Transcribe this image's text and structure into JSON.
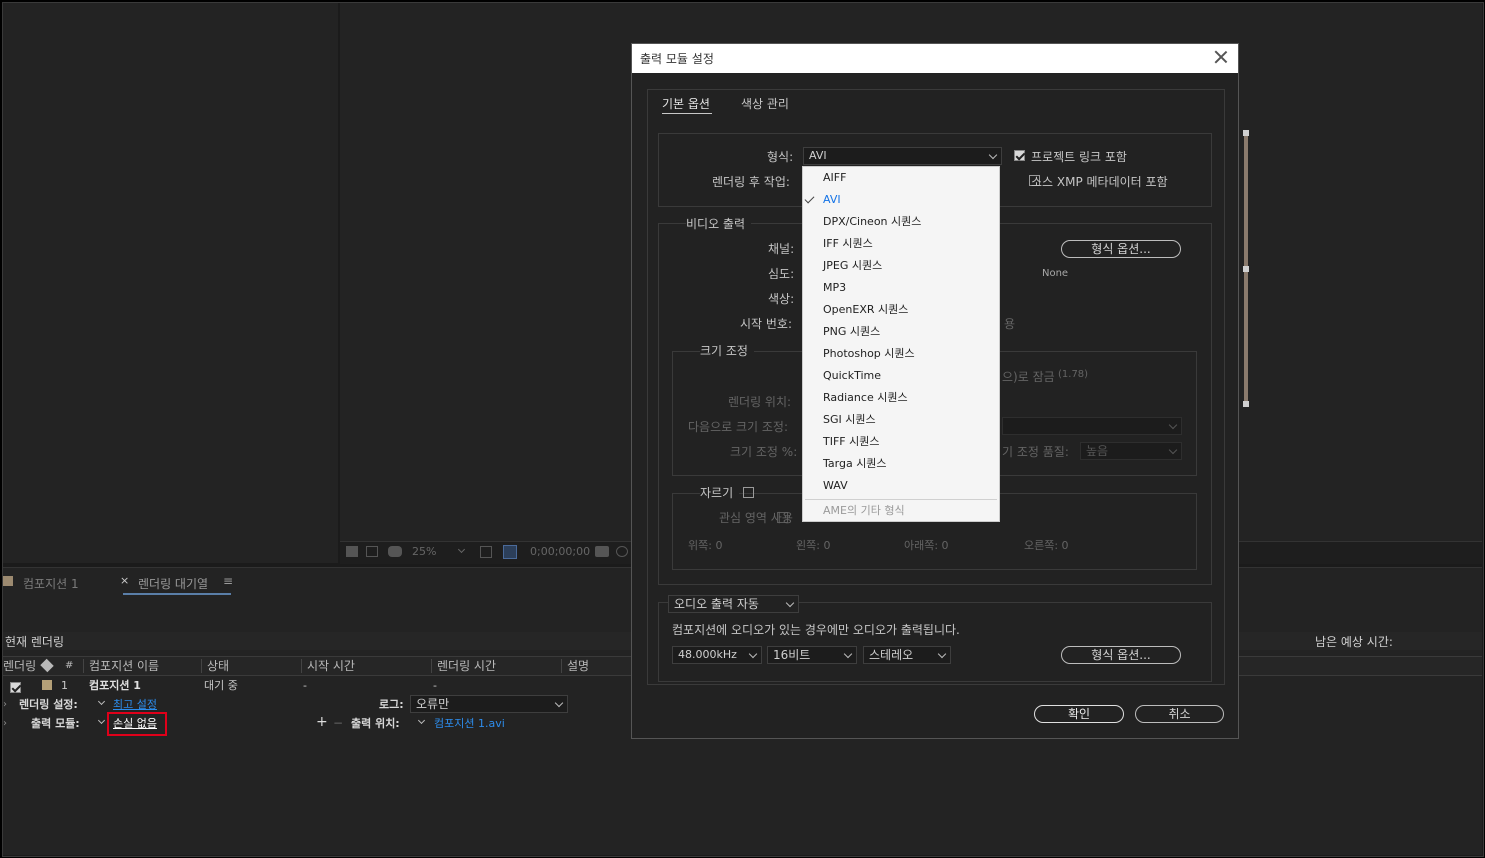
{
  "dialog": {
    "title": "출력 모듈 설정",
    "tabs": [
      "기본 옵션",
      "색상 관리"
    ],
    "format_label": "형식:",
    "format_value": "AVI",
    "post_render_label": "렌더링 후 작업:",
    "include_project_link": "프로젝트 링크 포함",
    "include_xmp": "소스 XMP 메타데이터 포함",
    "video_output": "비디오 출력",
    "channels_label": "채널:",
    "depth_label": "심도:",
    "color_label": "색상:",
    "start_number_label": "시작 번호:",
    "start_number_suffix": "용",
    "format_options_btn": "형식 옵션...",
    "codec_value": "None",
    "resize_label": "크기 조정",
    "lock_ratio_suffix": "으)로 잠금",
    "lock_ratio_value": "(1.78)",
    "render_at_label": "렌더링 위치:",
    "resize_to_label": "다음으로 크기 조정:",
    "resize_pct_label": "크기 조정 %:",
    "resize_quality_label": "기 조정 품질:",
    "resize_quality_value": "높음",
    "crop_label": "자르기",
    "roi_label": "관심 영역 사용",
    "crop_top": "위쪽: 0",
    "crop_left": "왼쪽: 0",
    "crop_bottom": "아래쪽: 0",
    "crop_right": "오른쪽: 0",
    "audio_output": "오디오 출력 자동",
    "audio_note": "컴포지션에 오디오가 있는 경우에만 오디오가 출력됩니다.",
    "sample_rate": "48.000kHz",
    "bit_depth": "16비트",
    "channels_audio": "스테레오",
    "audio_format_options_btn": "형식 옵션...",
    "ok_btn": "확인",
    "cancel_btn": "취소",
    "project_link_checked": true,
    "xmp_checked": false,
    "video_checked": true
  },
  "format_menu": {
    "items": [
      "AIFF",
      "AVI",
      "DPX/Cineon 시퀀스",
      "IFF 시퀀스",
      "JPEG 시퀀스",
      "MP3",
      "OpenEXR 시퀀스",
      "PNG 시퀀스",
      "Photoshop 시퀀스",
      "QuickTime",
      "Radiance 시퀀스",
      "SGI 시퀀스",
      "TIFF 시퀀스",
      "Targa 시퀀스",
      "WAV"
    ],
    "selected": "AVI",
    "more": "AME의 기타 형식"
  },
  "viewer": {
    "zoom": "25%",
    "timecode": "0;00;00;00"
  },
  "panels": {
    "comp_tab": "컴포지션 1",
    "render_queue_tab": "렌더링 대기열",
    "current_render": "현재 렌더링",
    "remaining_time": "남은 예상 시간:"
  },
  "queue": {
    "columns": [
      "렌더링",
      "#",
      "컴포지션 이름",
      "상태",
      "시작 시간",
      "렌더링 시간",
      "설명"
    ],
    "item": {
      "num": "1",
      "comp_name": "컴포지션 1",
      "status": "대기 중",
      "start": "-",
      "render_time": "-"
    },
    "render_settings_label": "렌더링 설정:",
    "render_settings_value": "최고 설정",
    "log_label": "로그:",
    "log_value": "오류만",
    "output_module_label": "출력 모듈:",
    "output_module_value": "손실 없음",
    "output_to_label": "출력 위치:",
    "output_to_value": "컴포지션 1.avi"
  }
}
